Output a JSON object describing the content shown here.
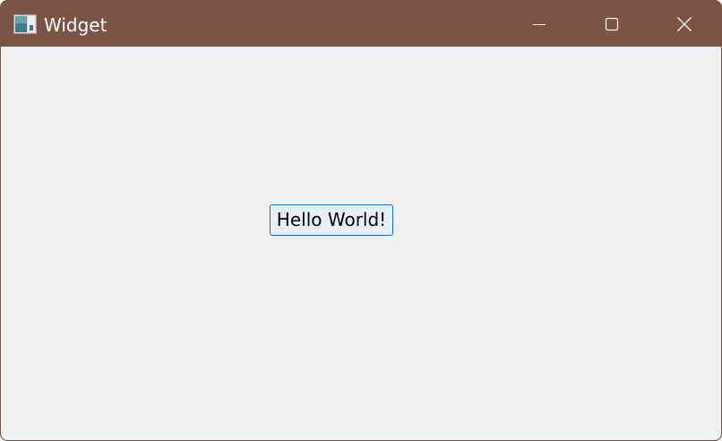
{
  "window": {
    "title": "Widget",
    "app_icon": "qt-widget-app-icon",
    "titlebar_color": "#7b5446",
    "client_background": "#f0f0f0",
    "caption_buttons": {
      "minimize_icon": "minimize-icon",
      "maximize_icon": "maximize-icon",
      "close_icon": "close-icon"
    }
  },
  "content": {
    "button_label": "Hello World!",
    "button_border_color": "#0f73c8",
    "button_fill_color": "#e6f0f8"
  }
}
